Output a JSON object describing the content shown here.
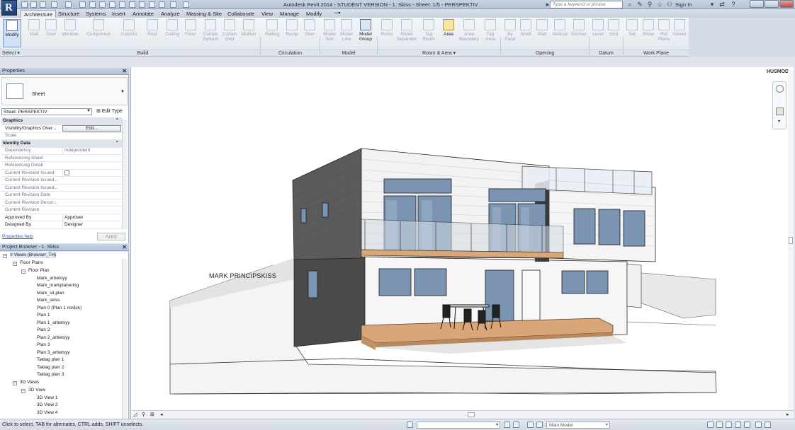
{
  "window": {
    "title": "Autodesk Revit 2014 - STUDENT VERSION -   1. Skiss - Sheet: 1/5 - PERSPEKTIV",
    "search_placeholder": "Type a keyword or phrase",
    "sign_in": "Sign In",
    "logo_letter": "R"
  },
  "tabs": [
    "Architecture",
    "Structure",
    "Systems",
    "Insert",
    "Annotate",
    "Analyze",
    "Massing & Site",
    "Collaborate",
    "View",
    "Manage",
    "Modify"
  ],
  "active_tab": "Architecture",
  "ribbon": {
    "select": {
      "modify": "Modify",
      "select_label": "Select ▾"
    },
    "build": {
      "label": "Build",
      "items": [
        "Wall",
        "Door",
        "Window",
        "Component",
        "Column",
        "Roof",
        "Ceiling",
        "Floor",
        "Curtain System",
        "Curtain Grid",
        "Mullion"
      ]
    },
    "circulation": {
      "label": "Circulation",
      "items": [
        "Railing",
        "Ramp",
        "Stair"
      ]
    },
    "model": {
      "label": "Model",
      "items": [
        "Model Text",
        "Model Line",
        "Model Group"
      ]
    },
    "room_area": {
      "label": "Room & Area ▾",
      "items": [
        "Room",
        "Room Separator",
        "Tag Room",
        "Area",
        "Area Boundary",
        "Tag Area"
      ]
    },
    "opening": {
      "label": "Opening",
      "items": [
        "By Face",
        "Shaft",
        "Wall",
        "Vertical",
        "Dormer"
      ]
    },
    "datum": {
      "label": "Datum",
      "items": [
        "Level",
        "Grid"
      ]
    },
    "work_plane": {
      "label": "Work Plane",
      "items": [
        "Set",
        "Show",
        "Ref Plane",
        "Viewer"
      ]
    }
  },
  "properties": {
    "header": "Properties",
    "type_name": "Sheet",
    "selector": "Sheet: PERSPEKTIV",
    "edit_type": "Edit Type",
    "sections": {
      "graphics": "Graphics",
      "identity": "Identity Data"
    },
    "graphics_rows": [
      {
        "key": "Visibility/Graphics Over...",
        "value": "Edit..."
      },
      {
        "key": "Scale",
        "value": ""
      }
    ],
    "identity_rows": [
      {
        "key": "Dependency",
        "value": "Independent"
      },
      {
        "key": "Referencing Sheet",
        "value": ""
      },
      {
        "key": "Referencing Detail",
        "value": ""
      },
      {
        "key": "Current Revision Issued",
        "value": ""
      },
      {
        "key": "Current Revision Issued...",
        "value": ""
      },
      {
        "key": "Current Revision Issued...",
        "value": ""
      },
      {
        "key": "Current Revision Date",
        "value": ""
      },
      {
        "key": "Current Revision Descri...",
        "value": ""
      },
      {
        "key": "Current Revision",
        "value": ""
      },
      {
        "key": "Approved By",
        "value": "Approver"
      },
      {
        "key": "Designed By",
        "value": "Designer"
      }
    ],
    "help": "Properties help",
    "apply": "Apply"
  },
  "browser": {
    "header": "Project Browser - 1. Skiss",
    "root": "Views (Browser_TH)",
    "floor_plans": "Floor Plans",
    "floor_plan": "Floor Plan",
    "plan_items": [
      "Mark_arbetsyy",
      "Mark_markplanering",
      "Mark_sit.plan",
      "Mark_skiss",
      "Plan 0 (Plan 1 nivåsk)",
      "Plan 1",
      "Plan 1_arbetsyy",
      "Plan 2",
      "Plan 2_arbetsyy",
      "Plan 3",
      "Plan 3_arbetsyy",
      "Taklag plan 1",
      "Taklag plan 2",
      "Taklag plan 3"
    ],
    "views_3d": "3D Views",
    "view_3d": "3D View",
    "items_3d": [
      "3D View 1",
      "3D View 2",
      "3D View 4"
    ]
  },
  "canvas": {
    "view_label": "MARK PRINCIPSKISS",
    "viewcube_label": "HUSMOD"
  },
  "status": {
    "text": "Click to select, TAB for alternates, CTRL adds, SHIFT unselects.",
    "model": "Main Model"
  }
}
